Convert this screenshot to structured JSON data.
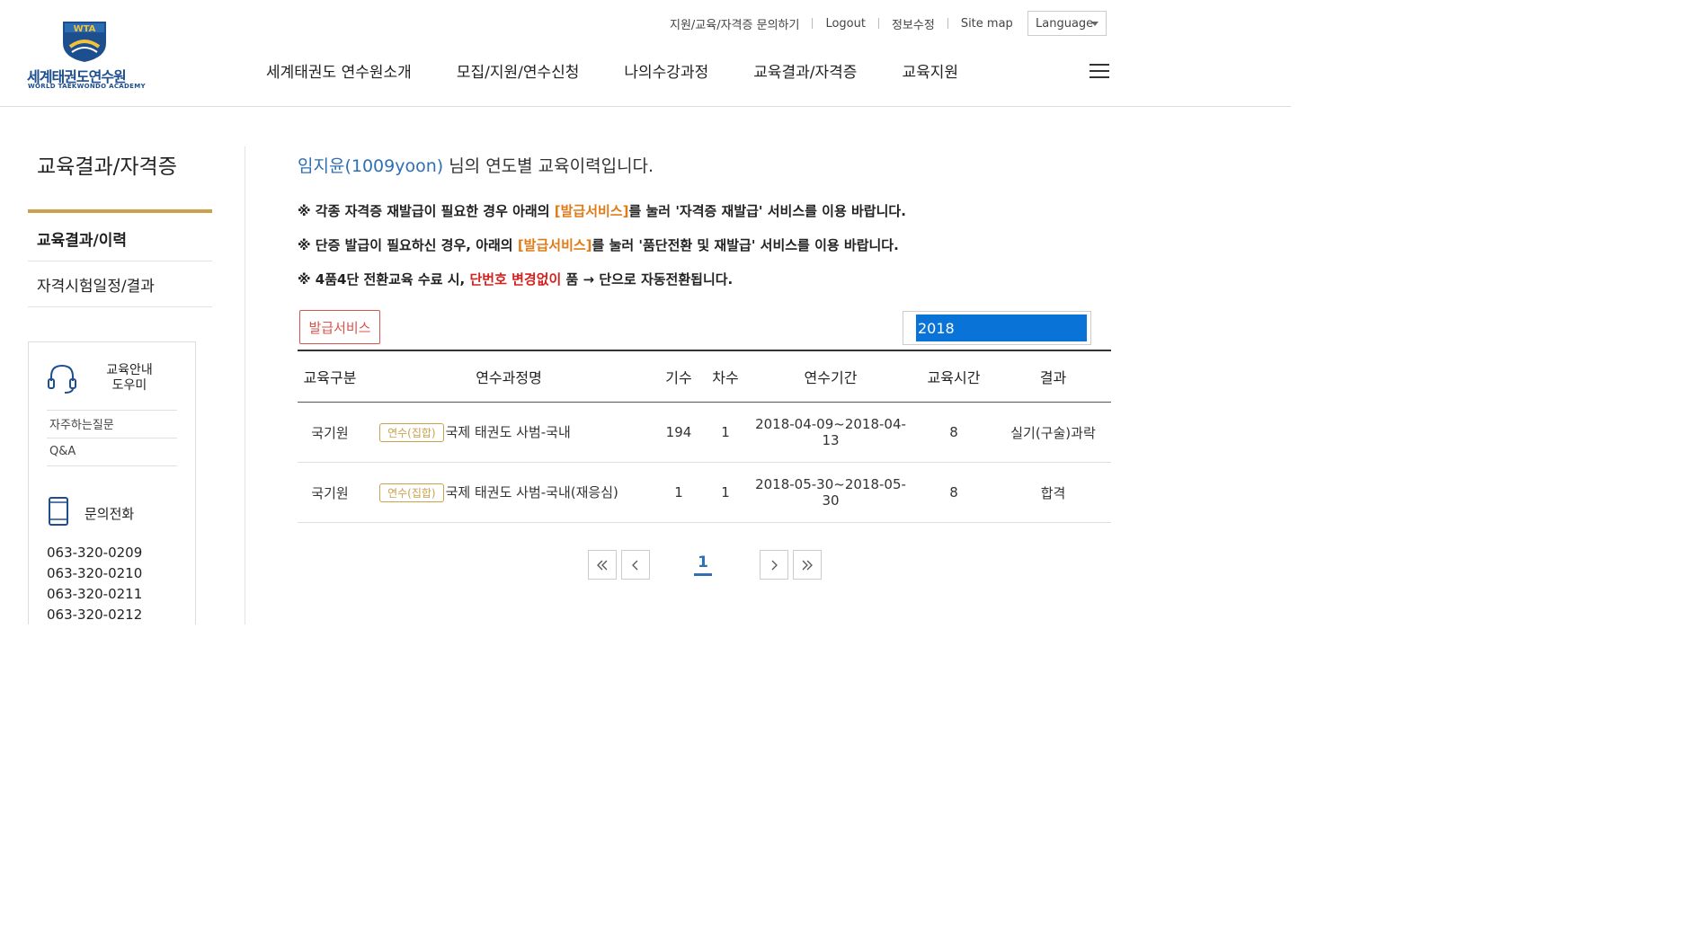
{
  "logo": {
    "emblem_text": "WTA",
    "name_kr": "세계태권도연수원",
    "name_en": "WORLD TAEKWONDO ACADEMY"
  },
  "utility": {
    "links": [
      "지원/교육/자격증 문의하기",
      "Logout",
      "정보수정",
      "Site map"
    ],
    "language": "Language"
  },
  "nav": {
    "items": [
      "세계태권도 연수원소개",
      "모집/지원/연수신청",
      "나의수강과정",
      "교육결과/자격증",
      "교육지원"
    ],
    "menu_icon": "hamburger-icon"
  },
  "sidebar": {
    "title": "교육결과/자격증",
    "items": [
      {
        "label": "교육결과/이력",
        "active": true
      },
      {
        "label": "자격시험일정/결과",
        "active": false
      }
    ],
    "help": {
      "title_line1": "교육안내",
      "title_line2": "도우미",
      "links": [
        "자주하는질문",
        "Q&A"
      ],
      "phone_title": "문의전화",
      "phones": [
        "063-320-0209",
        "063-320-0210",
        "063-320-0211",
        "063-320-0212"
      ]
    }
  },
  "main": {
    "heading_user": "임지윤(1009yoon)",
    "heading_rest": " 님의 연도별 교육이력입니다.",
    "notice1": {
      "pre": "※ 각종 자격증 재발급이 필요한 경우 아래의 ",
      "hl": "[발급서비스]",
      "post": "를 눌러 '자격증 재발급' 서비스를 이용 바랍니다."
    },
    "notice2": {
      "pre": "※ 단증 발급이 필요하신 경우, 아래의 ",
      "hl": "[발급서비스]",
      "post": "를 눌러 '품단전환 및 재발급' 서비스를 이용 바랍니다."
    },
    "notice3": {
      "pre": "※ 4품4단 전환교육 수료 시, ",
      "hl": "단번호 변경없이",
      "post": " 품 → 단으로 자동전환됩니다."
    },
    "issue_button": "발급서비스",
    "year_selected": "2018",
    "table": {
      "headers": [
        "교육구분",
        "연수과정명",
        "기수",
        "차수",
        "연수기간",
        "교육시간",
        "결과"
      ],
      "rows": [
        {
          "type": "국기원",
          "badge": "연수(집합)",
          "course": "국제 태권도 사범-국내",
          "gisu": "194",
          "chasu": "1",
          "period": "2018-04-09~2018-04-13",
          "hours": "8",
          "result": "실기(구술)과락"
        },
        {
          "type": "국기원",
          "badge": "연수(집합)",
          "course": "국제 태권도 사범-국내(재응심)",
          "gisu": "1",
          "chasu": "1",
          "period": "2018-05-30~2018-05-30",
          "hours": "8",
          "result": "합격"
        }
      ]
    },
    "pagination": {
      "current": "1"
    }
  },
  "colors": {
    "accent_gold": "#c9a24d",
    "user_blue": "#2f6fb3",
    "highlight_orange": "#e07b17",
    "warn_red": "#d61f1f",
    "select_blue": "#0a73d7"
  }
}
